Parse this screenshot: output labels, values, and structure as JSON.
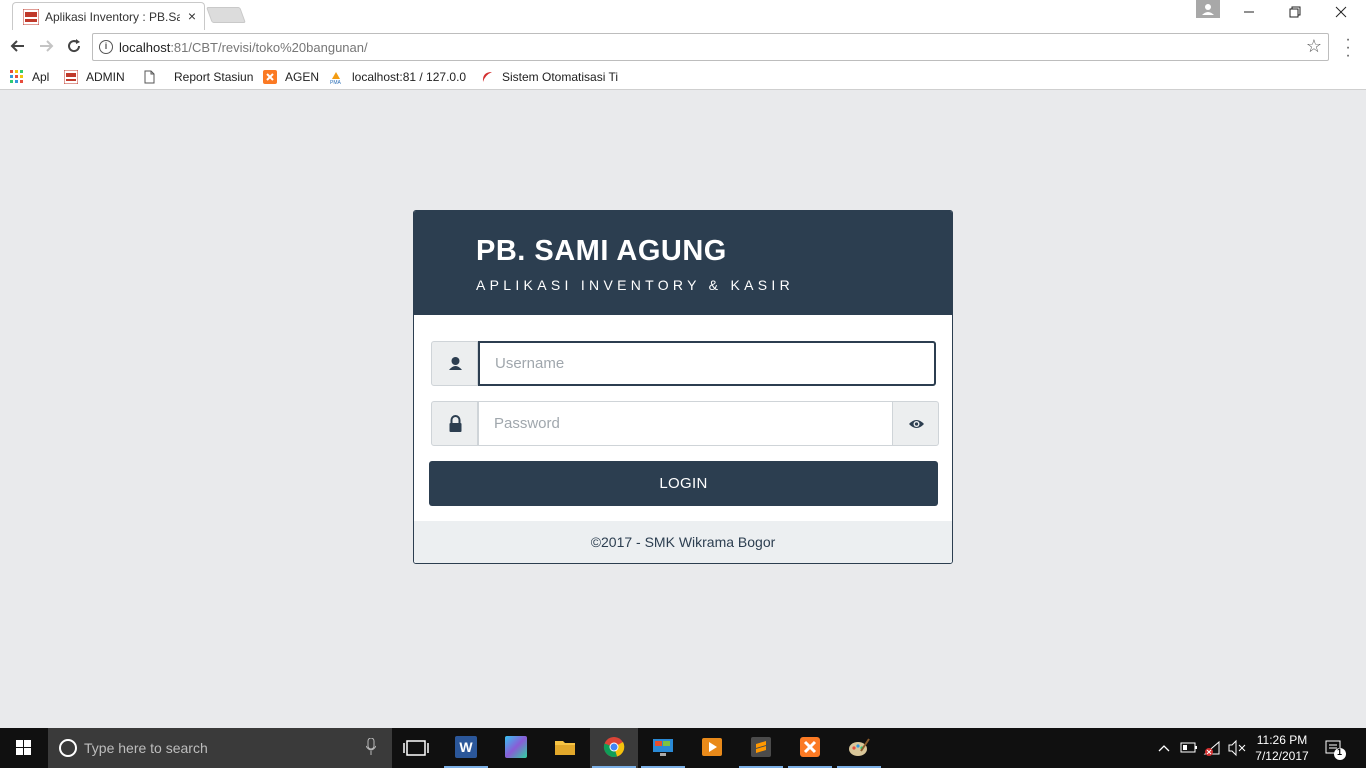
{
  "browser": {
    "tab_title": "Aplikasi Inventory : PB.Sami Agung",
    "tab_close": "×",
    "url_host": "localhost",
    "url_path": ":81/CBT/revisi/toko%20bangunan/",
    "bookmarks": [
      {
        "label": "Apl",
        "icon": "apps-grid-icon"
      },
      {
        "label": "ADMIN",
        "icon": "site-favicon-icon"
      },
      {
        "label": "Report Stasiun",
        "icon": "document-icon"
      },
      {
        "label": "AGEN",
        "icon": "xampp-icon"
      },
      {
        "label": "localhost:81 / 127.0.0",
        "icon": "phpmyadmin-icon"
      },
      {
        "label": "Sistem Otomatisasi Ti",
        "icon": "red-swoosh-icon"
      }
    ]
  },
  "login": {
    "brand_title": "PB. SAMI AGUNG",
    "brand_subtitle": "APLIKASI INVENTORY & KASIR",
    "username_placeholder": "Username",
    "password_placeholder": "Password",
    "login_label": "LOGIN",
    "footer": "©2017 - SMK Wikrama Bogor"
  },
  "taskbar": {
    "search_placeholder": "Type here to search",
    "time": "11:26 PM",
    "date": "7/12/2017",
    "notification_count": "1"
  },
  "colors": {
    "primary": "#2c3e50",
    "background": "#e9eaec"
  }
}
